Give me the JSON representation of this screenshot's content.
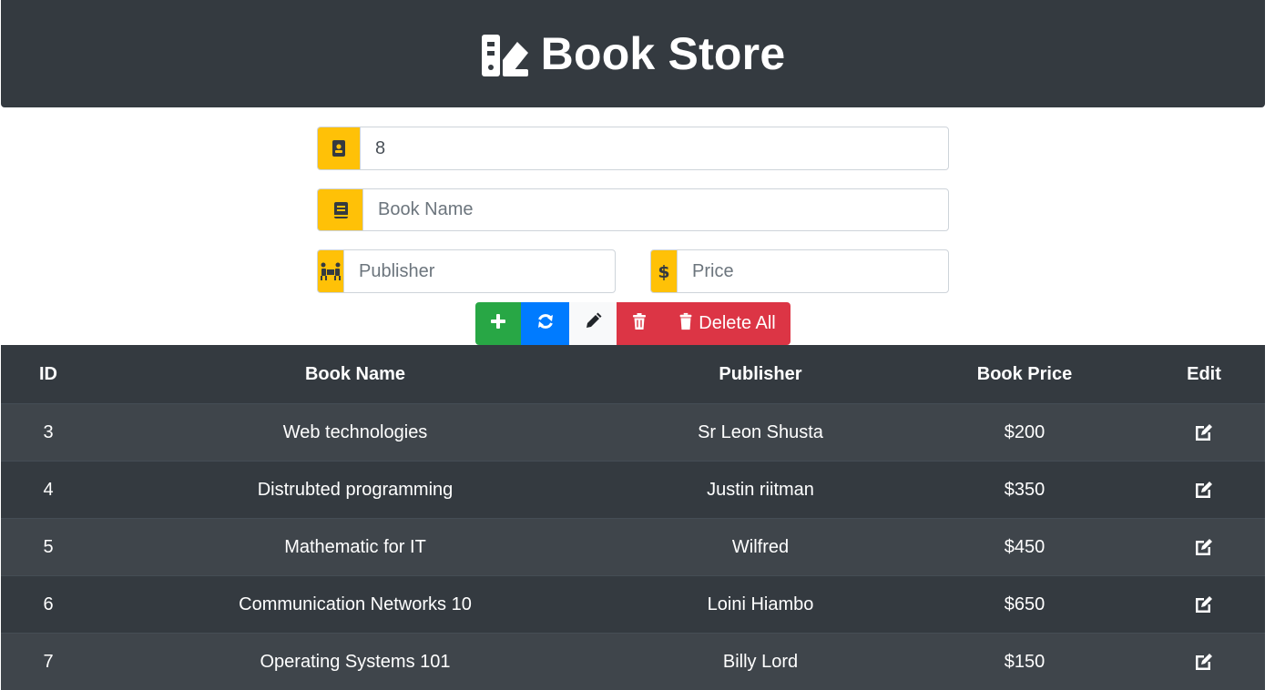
{
  "app": {
    "title": "Book Store",
    "logo_icon": "book-shelf-icon"
  },
  "form": {
    "id_value": "8",
    "id_icon": "id-card-icon",
    "book_name_placeholder": "Book Name",
    "book_name_icon": "book-icon",
    "publisher_placeholder": "Publisher",
    "publisher_icon": "people-carry-icon",
    "price_placeholder": "Price",
    "price_icon": "dollar-icon"
  },
  "toolbar": {
    "add_icon": "plus-icon",
    "refresh_icon": "sync-icon",
    "edit_icon": "pencil-icon",
    "delete_icon": "trash-icon",
    "delete_all_label": "Delete All"
  },
  "table": {
    "headers": [
      "ID",
      "Book Name",
      "Publisher",
      "Book Price",
      "Edit"
    ],
    "rows": [
      {
        "id": "3",
        "name": "Web technologies",
        "publisher": "Sr Leon Shusta",
        "price": "$200"
      },
      {
        "id": "4",
        "name": "Distrubted programming",
        "publisher": "Justin riitman",
        "price": "$350"
      },
      {
        "id": "5",
        "name": "Mathematic for IT",
        "publisher": "Wilfred",
        "price": "$450"
      },
      {
        "id": "6",
        "name": "Communication Networks 10",
        "publisher": "Loini Hiambo",
        "price": "$650"
      },
      {
        "id": "7",
        "name": "Operating Systems 101",
        "publisher": "Billy Lord",
        "price": "$150"
      }
    ]
  },
  "colors": {
    "header_bg": "#343a40",
    "accent_yellow": "#ffc107",
    "success": "#28a745",
    "primary": "#007bff",
    "light": "#f8f9fa",
    "danger": "#dc3545"
  }
}
